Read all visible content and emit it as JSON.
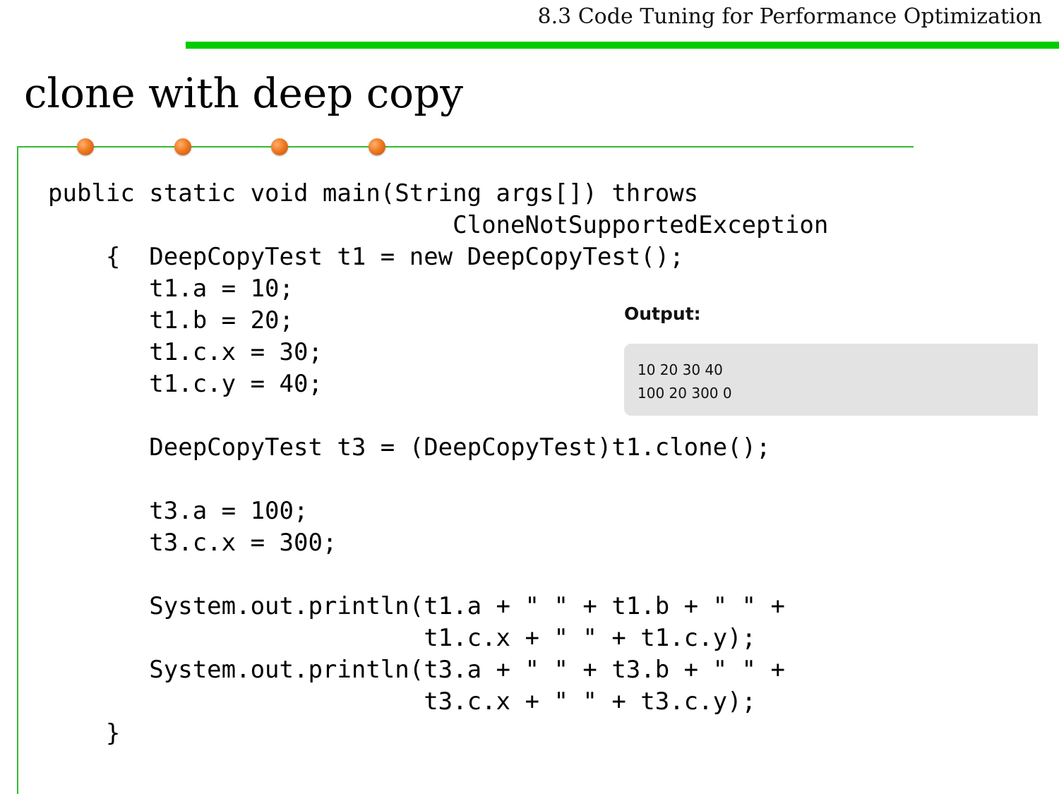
{
  "header": {
    "section_title": "8.3 Code Tuning for Performance Optimization",
    "accent_color": "#00cc00"
  },
  "slide": {
    "title": "clone with deep copy",
    "frame_color": "#33bb33",
    "bullet_dot_color": "#f07a20"
  },
  "code": {
    "lines": [
      "public static void main(String args[]) throws",
      "                            CloneNotSupportedException",
      "    {  DeepCopyTest t1 = new DeepCopyTest();",
      "       t1.a = 10;",
      "       t1.b = 20;",
      "       t1.c.x = 30;",
      "       t1.c.y = 40;",
      "",
      "       DeepCopyTest t3 = (DeepCopyTest)t1.clone();",
      "",
      "       t3.a = 100;",
      "       t3.c.x = 300;",
      "",
      "       System.out.println(t1.a + \" \" + t1.b + \" \" +",
      "                          t1.c.x + \" \" + t1.c.y);",
      "       System.out.println(t3.a + \" \" + t3.b + \" \" +",
      "                          t3.c.x + \" \" + t3.c.y);",
      "    }"
    ]
  },
  "output": {
    "label": "Output:",
    "lines": [
      "10 20 30 40",
      "100 20 300 0"
    ]
  }
}
